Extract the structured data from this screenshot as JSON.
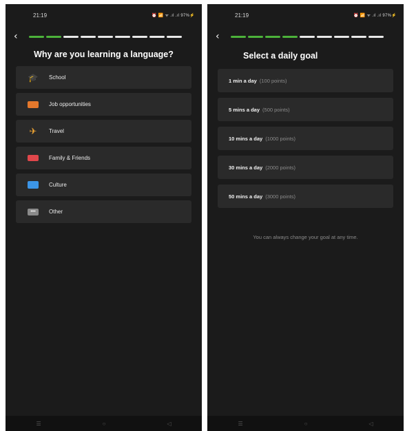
{
  "left": {
    "status": {
      "time": "21:19",
      "system": "⏰ 📶 ᯤ .ıl .ıl 97%⚡"
    },
    "progress": {
      "total": 9,
      "done": 2
    },
    "back_icon": "chevron-left-icon",
    "title": "Why are you learning a language?",
    "options": [
      {
        "label": "School",
        "icon": "graduation-cap-icon"
      },
      {
        "label": "Job opportunities",
        "icon": "briefcase-icon"
      },
      {
        "label": "Travel",
        "icon": "airplane-icon"
      },
      {
        "label": "Family & Friends",
        "icon": "sofa-icon"
      },
      {
        "label": "Culture",
        "icon": "tv-icon"
      },
      {
        "label": "Other",
        "icon": "dots-icon"
      }
    ],
    "nav": [
      "☰",
      "○",
      "◁"
    ]
  },
  "right": {
    "status": {
      "time": "21:19",
      "system": "⏰ 📶 ᯤ .ıl .ıl 97%⚡"
    },
    "progress": {
      "total": 9,
      "done": 4
    },
    "back_icon": "chevron-left-icon",
    "title": "Select a daily goal",
    "goals": [
      {
        "label": "1 min a day",
        "points": "(100 points)"
      },
      {
        "label": "5 mins a day",
        "points": "(500 points)"
      },
      {
        "label": "10 mins a day",
        "points": "(1000 points)"
      },
      {
        "label": "30 mins a day",
        "points": "(2000 points)"
      },
      {
        "label": "50 mins a day",
        "points": "(3000 points)"
      }
    ],
    "hint": "You can always change your goal at any time.",
    "nav": [
      "☰",
      "○",
      "◁"
    ]
  },
  "colors": {
    "background": "#1b1b1b",
    "card": "#2a2a2a",
    "accent_green": "#4cb23a"
  }
}
